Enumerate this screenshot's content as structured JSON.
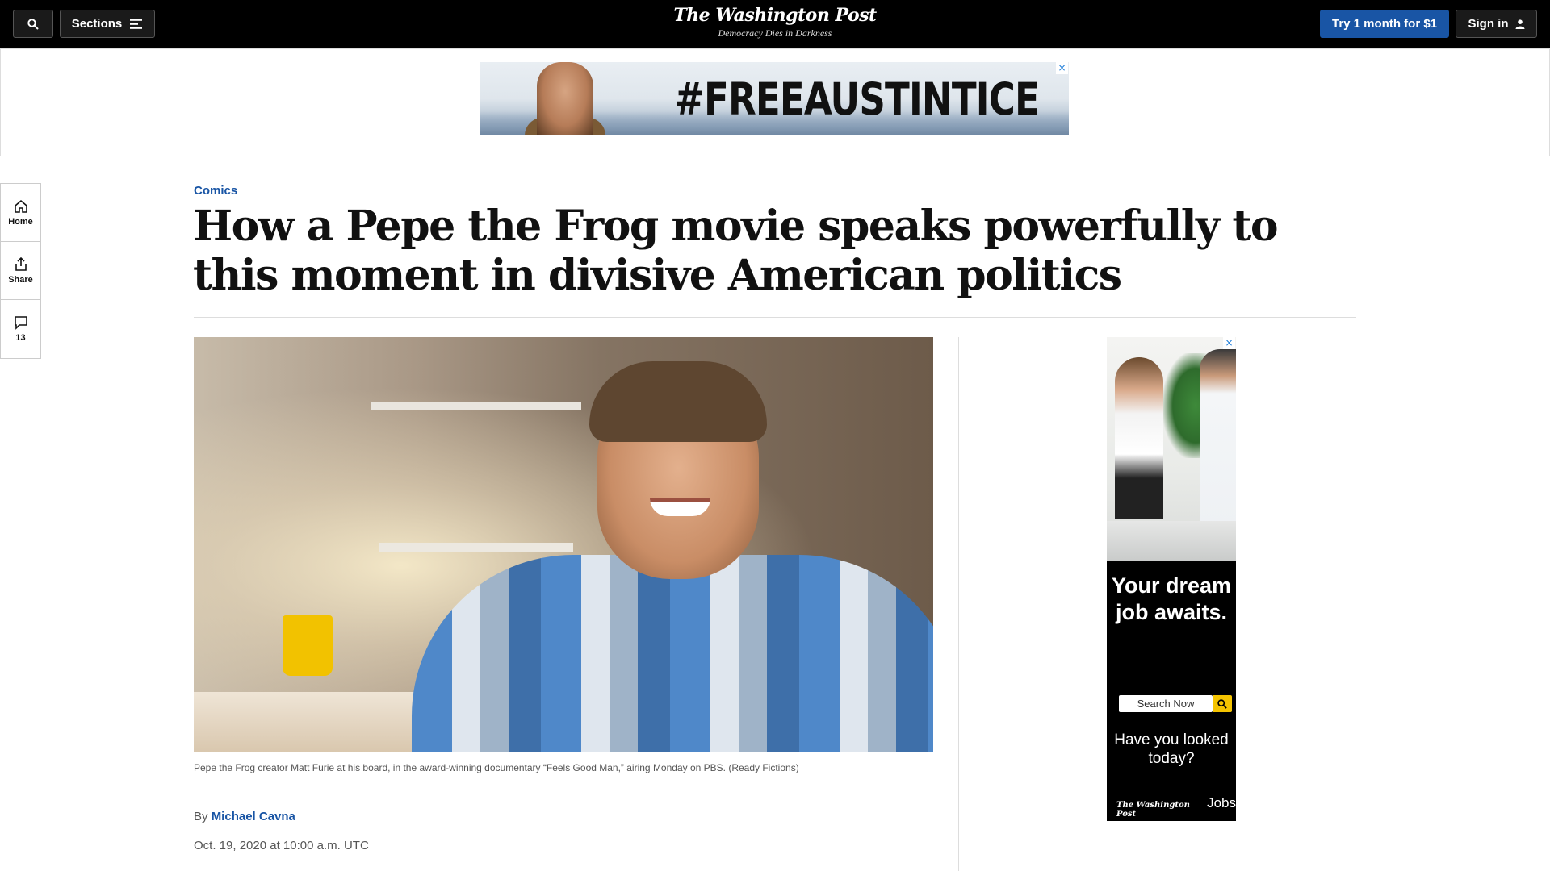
{
  "header": {
    "sections_label": "Sections",
    "logo_name": "The Washington Post",
    "logo_tagline": "Democracy Dies in Darkness",
    "trial_label": "Try 1 month for $1",
    "signin_label": "Sign in"
  },
  "top_ad": {
    "text": "#FREEAUSTINTICE",
    "close": "×"
  },
  "rail": {
    "home_label": "Home",
    "share_label": "Share",
    "comments_count": "13"
  },
  "article": {
    "kicker": "Comics",
    "headline": "How a Pepe the Frog movie speaks powerfully to this moment in divisive American politics",
    "caption": "Pepe the Frog creator Matt Furie at his board, in the award-winning documentary “Feels Good Man,” airing Monday on PBS. (Ready Fictions)",
    "byline_prefix": "By",
    "author": "Michael Cavna",
    "date": "Oct. 19, 2020 at 10:00 a.m. UTC"
  },
  "side_ad": {
    "headline": "Your dream job awaits.",
    "search_label": "Search Now",
    "subtext": "Have you looked today?",
    "brand": "The Washington Post",
    "brand_suffix": "Jobs",
    "close": "×"
  },
  "colors": {
    "accent_blue": "#1955a5",
    "topbar": "#000000",
    "jobs_yellow": "#f5c400"
  }
}
